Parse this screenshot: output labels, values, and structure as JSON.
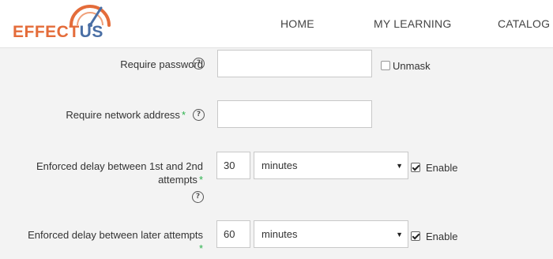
{
  "header": {
    "logo_main": "EFFECT",
    "logo_accent": "US",
    "nav": [
      {
        "label": "HOME"
      },
      {
        "label": "MY LEARNING"
      },
      {
        "label": "CATALOG"
      }
    ]
  },
  "form": {
    "require_password": {
      "label": "Require password",
      "help": "?",
      "value": "",
      "unmask_label": "Unmask",
      "unmask_checked": false
    },
    "require_network": {
      "label": "Require network address",
      "required_mark": "*",
      "help": "?",
      "value": ""
    },
    "delay_first_second": {
      "label_line1": "Enforced delay between 1st and 2nd",
      "label_line2": "attempts",
      "required_mark": "*",
      "help": "?",
      "value": "30",
      "unit": "minutes",
      "enable_label": "Enable",
      "enabled": true
    },
    "delay_later": {
      "label": "Enforced delay between later attempts",
      "required_mark": "*",
      "value": "60",
      "unit": "minutes",
      "enable_label": "Enable",
      "enabled": true
    }
  },
  "colors": {
    "logo_orange": "#e46c3a",
    "logo_blue": "#4a6fa5",
    "required_green": "#2bb24c"
  }
}
